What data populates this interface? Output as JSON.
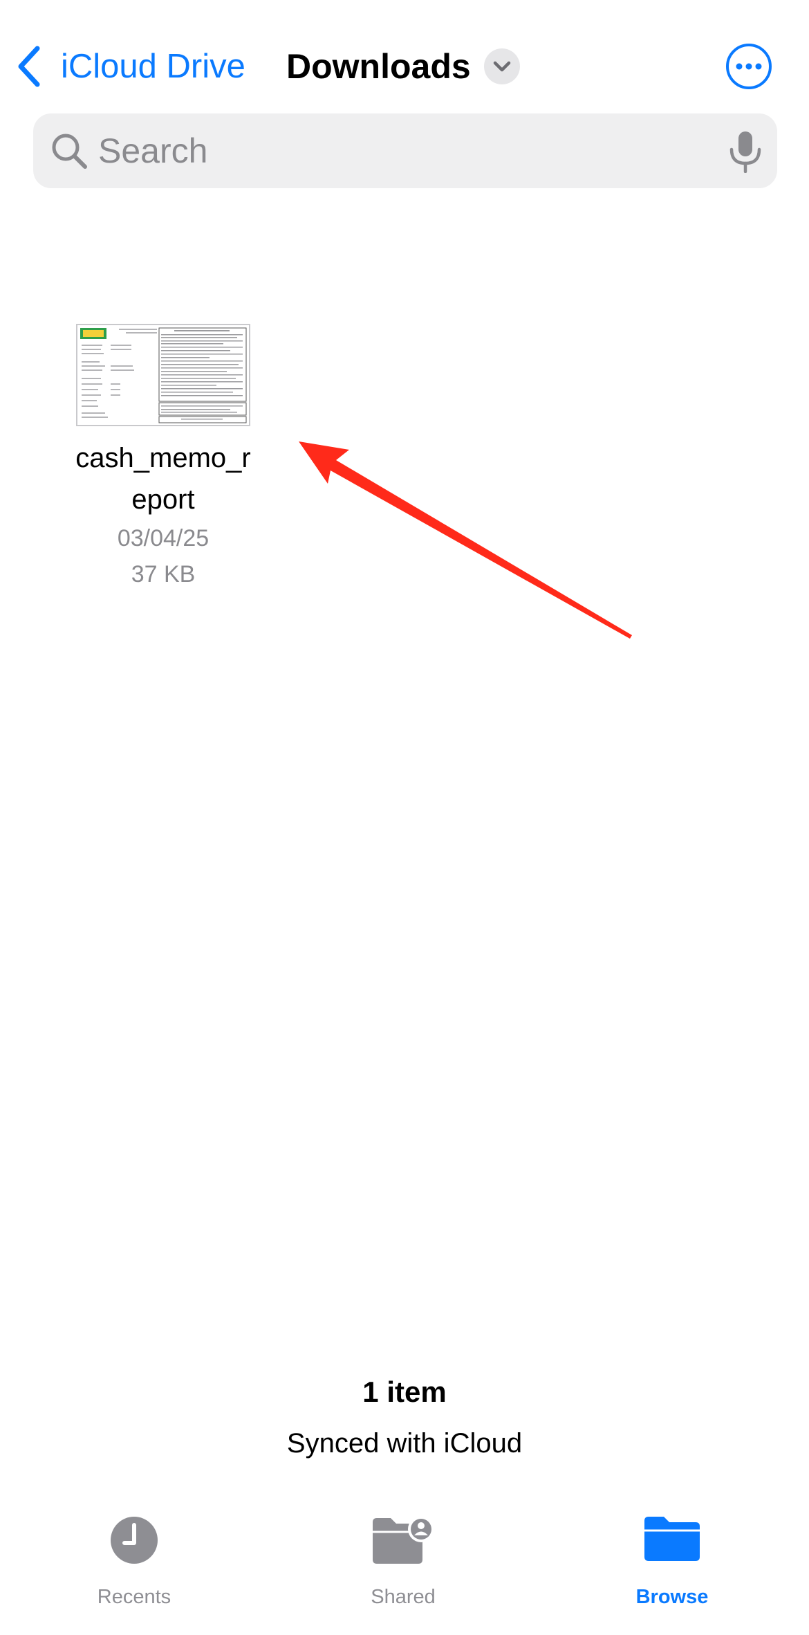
{
  "nav": {
    "back_label": "iCloud Drive",
    "title": "Downloads"
  },
  "search": {
    "placeholder": "Search",
    "value": ""
  },
  "files": [
    {
      "name": "cash_memo_report",
      "name_line1": "cash_memo_r",
      "name_line2": "eport",
      "date": "03/04/25",
      "size": "37 KB"
    }
  ],
  "footer": {
    "item_count": "1 item",
    "sync_status": "Synced with iCloud"
  },
  "tabs": [
    {
      "label": "Recents",
      "icon": "clock-icon",
      "active": false
    },
    {
      "label": "Shared",
      "icon": "shared-folder-icon",
      "active": false
    },
    {
      "label": "Browse",
      "icon": "folder-icon",
      "active": true
    }
  ],
  "colors": {
    "accent": "#0a7aff",
    "inactive": "#8e8e93",
    "annotation": "#ff2a1a"
  }
}
